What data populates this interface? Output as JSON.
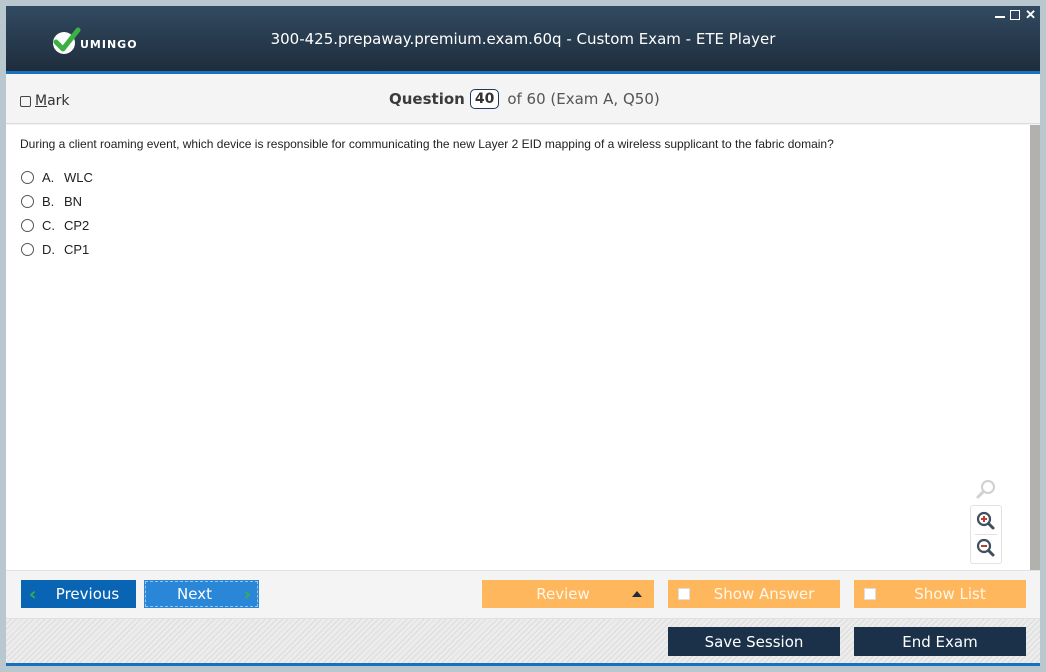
{
  "window": {
    "title": "300-425.prepaway.premium.exam.60q - Custom Exam - ETE Player",
    "logo_text": "UMINGO",
    "controls": {
      "minimize": "minimize-icon",
      "maximize": "maximize-icon",
      "close": "✕"
    }
  },
  "header": {
    "mark_label_underlined": "M",
    "mark_label_rest": "ark",
    "mark_checked": false,
    "question_label": "Question",
    "question_number": "40",
    "question_of": "of 60 (Exam A, Q50)"
  },
  "question": {
    "text": "During a client roaming event, which device is responsible for communicating the new Layer 2 EID mapping of a wireless supplicant to the fabric domain?",
    "options": [
      {
        "letter": "A.",
        "text": "WLC",
        "selected": false
      },
      {
        "letter": "B.",
        "text": "BN",
        "selected": false
      },
      {
        "letter": "C.",
        "text": "CP2",
        "selected": false
      },
      {
        "letter": "D.",
        "text": "CP1",
        "selected": false
      }
    ]
  },
  "zoom_tools": [
    "search-icon",
    "zoom-in-icon",
    "zoom-out-icon"
  ],
  "nav": {
    "previous": "Previous",
    "next": "Next",
    "review": "Review",
    "show_answer": "Show Answer",
    "show_list": "Show List"
  },
  "footer": {
    "save_session": "Save Session",
    "end_exam": "End Exam"
  },
  "colors": {
    "titlebar": "#1e2d3d",
    "accent_blue": "#1b6fbf",
    "previous_btn": "#0a64b4",
    "next_btn": "#2a87d8",
    "orange_btn": "#ffb75e",
    "dark_btn": "#1b3149",
    "chevron_green": "#3cb043"
  }
}
